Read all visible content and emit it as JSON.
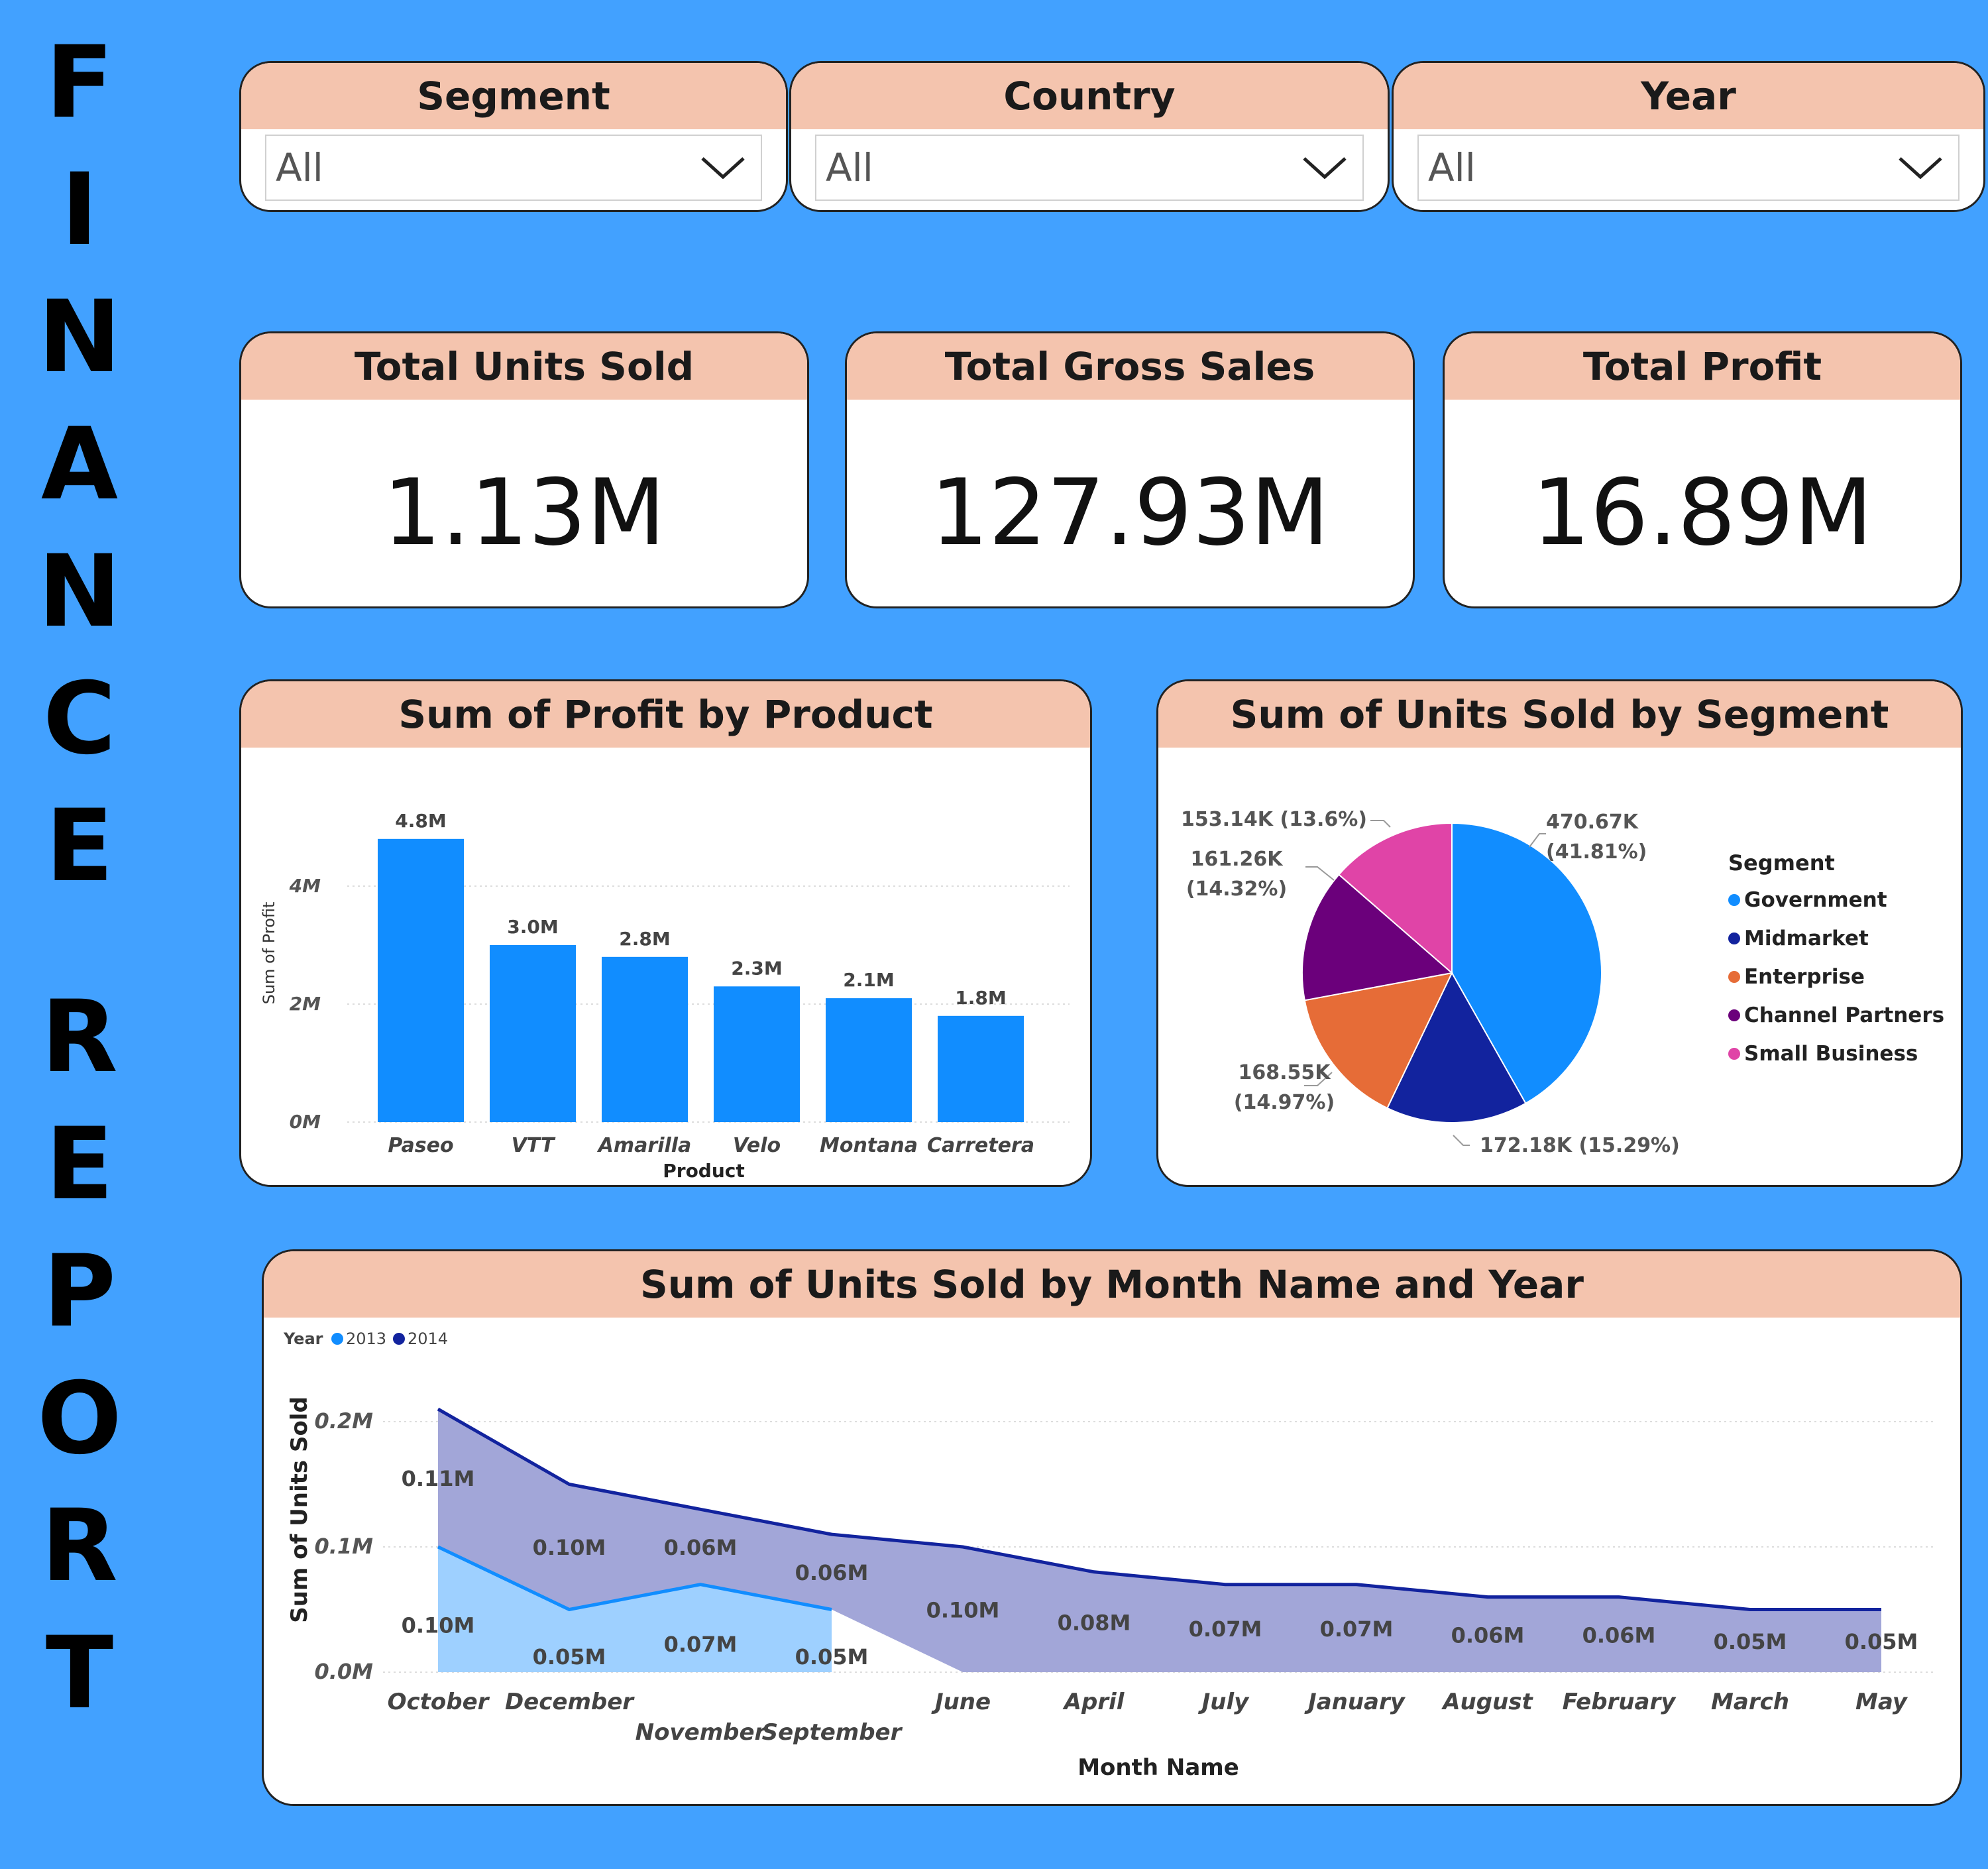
{
  "report_title_letters": [
    "F",
    "I",
    "N",
    "A",
    "N",
    "C",
    "E",
    "R",
    "E",
    "P",
    "O",
    "R",
    "T"
  ],
  "slicers": [
    {
      "label": "Segment",
      "value": "All",
      "icon": "chevron-down-icon"
    },
    {
      "label": "Country",
      "value": "All",
      "icon": "chevron-down-icon"
    },
    {
      "label": "Year",
      "value": "All",
      "icon": "chevron-down-icon"
    }
  ],
  "kpis": [
    {
      "label": "Total Units Sold",
      "value": "1.13M"
    },
    {
      "label": "Total Gross Sales",
      "value": "127.93M"
    },
    {
      "label": "Total Profit",
      "value": "16.89M"
    }
  ],
  "colors": {
    "background": "#42A1FF",
    "header": "#F4C4AE",
    "bar": "#118DFF",
    "government": "#118DFF",
    "midmarket": "#12239E",
    "enterprise": "#E66C37",
    "channel_partners": "#6B007B",
    "small_business": "#E044A7",
    "year_2013": "#118DFF",
    "year_2014": "#12239E"
  },
  "chart_data": [
    {
      "type": "bar",
      "title": "Sum of Profit by Product",
      "xlabel": "Product",
      "ylabel": "Sum of Profit",
      "categories": [
        "Paseo",
        "VTT",
        "Amarilla",
        "Velo",
        "Montana",
        "Carretera"
      ],
      "values": [
        4.8,
        3.0,
        2.8,
        2.3,
        2.1,
        1.8
      ],
      "data_labels": [
        "4.8M",
        "3.0M",
        "2.8M",
        "2.3M",
        "2.1M",
        "1.8M"
      ],
      "yticks": [
        "0M",
        "2M",
        "4M"
      ],
      "ylim": [
        0,
        5
      ],
      "unit": "M",
      "grid": true
    },
    {
      "type": "pie",
      "title": "Sum of Units Sold by Segment",
      "legend_title": "Segment",
      "legend_position": "right",
      "slices": [
        {
          "name": "Government",
          "value": 470670,
          "label": "470.67K (41.81%)"
        },
        {
          "name": "Midmarket",
          "value": 172180,
          "label": "172.18K (15.29%)"
        },
        {
          "name": "Enterprise",
          "value": 168550,
          "label": "168.55K (14.97%)"
        },
        {
          "name": "Channel Partners",
          "value": 161260,
          "label": "161.26K (14.32%)"
        },
        {
          "name": "Small Business",
          "value": 153140,
          "label": "153.14K (13.6%)"
        }
      ]
    },
    {
      "type": "area",
      "title": "Sum of Units Sold by Month Name and Year",
      "xlabel": "Month Name",
      "ylabel": "Sum of Units Sold",
      "legend_title": "Year",
      "legend_position": "top-left",
      "categories": [
        "October",
        "December",
        "November",
        "September",
        "June",
        "April",
        "July",
        "January",
        "August",
        "February",
        "March",
        "May"
      ],
      "yticks": [
        "0.0M",
        "0.1M",
        "0.2M"
      ],
      "ylim": [
        0,
        0.2
      ],
      "stacked": true,
      "series": [
        {
          "name": "2013",
          "values": [
            0.1,
            0.05,
            0.07,
            0.05,
            null,
            null,
            null,
            null,
            null,
            null,
            null,
            null
          ],
          "labels": [
            "0.10M",
            "0.05M",
            "0.07M",
            "0.05M",
            "",
            "",
            "",
            "",
            "",
            "",
            "",
            ""
          ]
        },
        {
          "name": "2014",
          "values": [
            0.11,
            0.1,
            0.06,
            0.06,
            0.1,
            0.08,
            0.07,
            0.07,
            0.06,
            0.06,
            0.05,
            0.05
          ],
          "labels": [
            "0.11M",
            "0.10M",
            "0.06M",
            "0.06M",
            "0.10M",
            "0.08M",
            "0.07M",
            "0.07M",
            "0.06M",
            "0.06M",
            "0.05M",
            "0.05M"
          ]
        }
      ]
    }
  ]
}
